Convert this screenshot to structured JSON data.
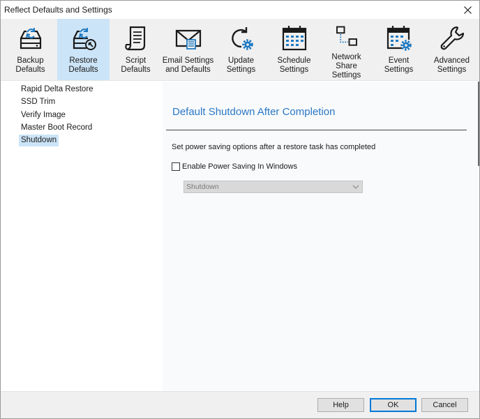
{
  "window": {
    "title": "Reflect Defaults and Settings",
    "close_icon": "close-icon"
  },
  "toolbar": {
    "active_index": 1,
    "items": [
      {
        "label": "Backup\nDefaults",
        "icon": "backup-drive-icon"
      },
      {
        "label": "Restore\nDefaults",
        "icon": "restore-drive-icon"
      },
      {
        "label": "Script\nDefaults",
        "icon": "script-document-icon"
      },
      {
        "label": "Email Settings\nand Defaults",
        "icon": "email-envelope-icon"
      },
      {
        "label": "Update\nSettings",
        "icon": "update-gear-icon"
      },
      {
        "label": "Schedule\nSettings",
        "icon": "calendar-icon"
      },
      {
        "label": "Network Share\nSettings",
        "icon": "network-share-icon"
      },
      {
        "label": "Event\nSettings",
        "icon": "event-calendar-gear-icon"
      },
      {
        "label": "Advanced\nSettings",
        "icon": "wrench-icon"
      }
    ]
  },
  "sidebar": {
    "selected_index": 4,
    "items": [
      {
        "label": "Rapid Delta Restore"
      },
      {
        "label": "SSD Trim"
      },
      {
        "label": "Verify Image"
      },
      {
        "label": "Master Boot Record"
      },
      {
        "label": "Shutdown"
      }
    ]
  },
  "content": {
    "heading": "Default Shutdown After Completion",
    "description": "Set power saving options after a restore task has completed",
    "checkbox": {
      "label": "Enable Power Saving In Windows",
      "checked": false
    },
    "select": {
      "value": "Shutdown",
      "enabled": false
    }
  },
  "footer": {
    "help_label": "Help",
    "ok_label": "OK",
    "cancel_label": "Cancel"
  },
  "colors": {
    "accent": "#2b78c5",
    "selected_bg": "#cce4f7",
    "icon_blue": "#1f7ac2",
    "icon_dark": "#1a1a1a"
  }
}
